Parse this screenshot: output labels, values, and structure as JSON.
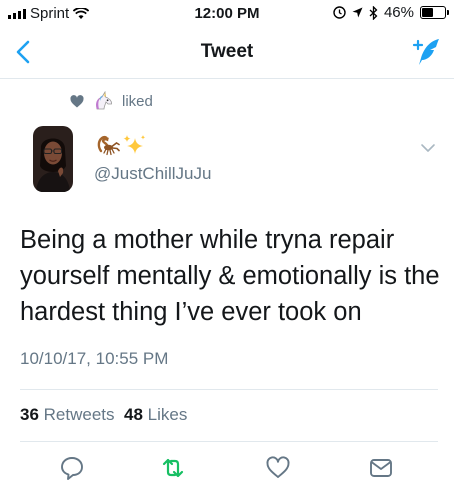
{
  "status_bar": {
    "carrier": "Sprint",
    "time": "12:00 PM",
    "battery": "46%",
    "battery_level": 0.46
  },
  "nav": {
    "title": "Tweet"
  },
  "liked_label": "liked",
  "author": {
    "handle": "@JustChillJuJu"
  },
  "tweet": {
    "text": "Being a mother while tryna repair yourself mentally & emotionally is the hardest thing I’ve ever took on",
    "timestamp": "10/10/17, 10:55 PM",
    "retweets": "36",
    "retweets_label": "Retweets",
    "likes": "48",
    "likes_label": "Likes"
  },
  "colors": {
    "accent": "#1da1f2",
    "retweet": "#17bf63",
    "muted": "#657786"
  },
  "icons": [
    "heart-icon",
    "unicorn-icon",
    "scorpion-icon",
    "sparkles-icon",
    "chevron-down-icon",
    "reply-icon",
    "retweet-icon",
    "like-icon",
    "message-icon",
    "back-icon",
    "compose-icon",
    "wifi-icon",
    "location-icon",
    "bluetooth-icon",
    "alarm-icon"
  ]
}
